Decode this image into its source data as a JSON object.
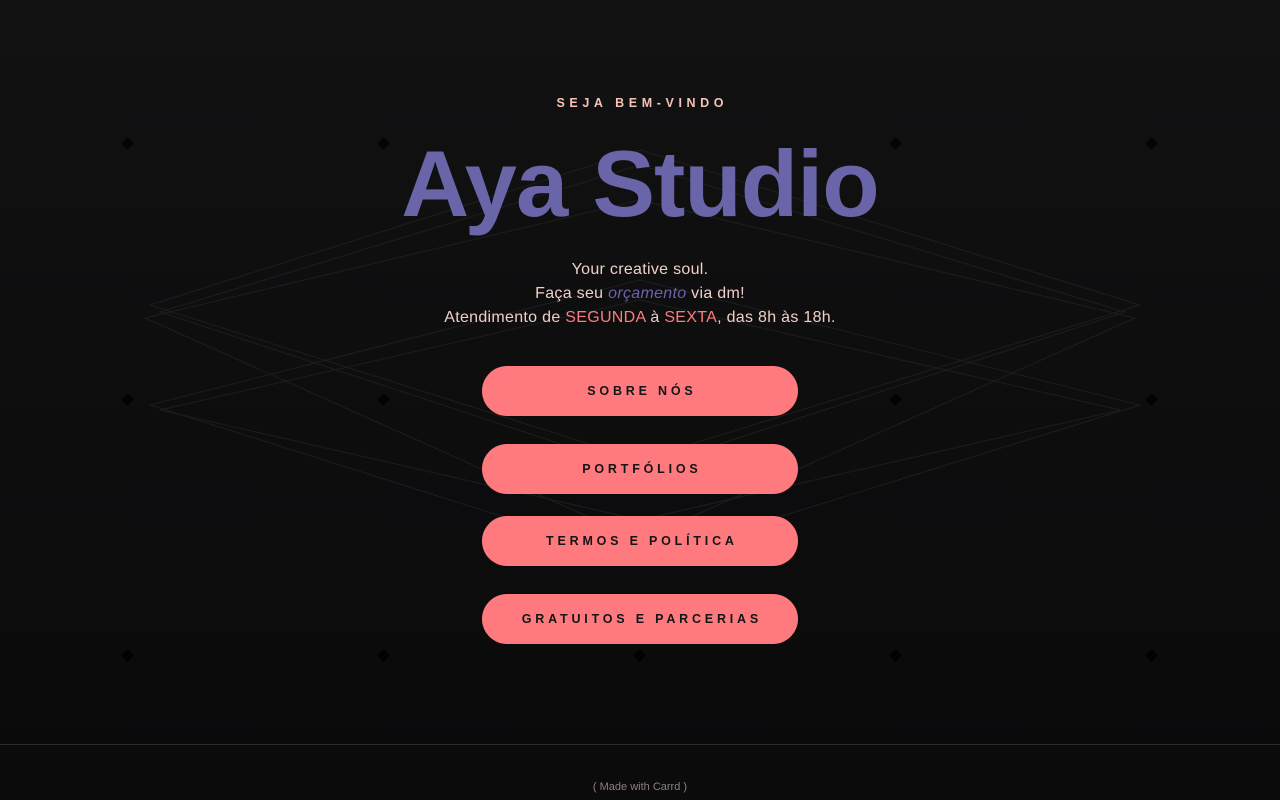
{
  "hero": {
    "eyebrow": "SEJA BEM-VINDO",
    "title": "Aya Studio",
    "line1": "Your creative soul.",
    "line2_pre": "Faça seu ",
    "line2_em": "orçamento",
    "line2_post": " via dm!",
    "line3_pre": "Atendimento de ",
    "line3_day1": "SEGUNDA",
    "line3_mid": " à ",
    "line3_day2": "SEXTA",
    "line3_post": ", das 8h às 18h."
  },
  "buttons": {
    "about": "SOBRE NÓS",
    "portfolios": "PORTFÓLIOS",
    "terms": "TERMOS E POLÍTICA",
    "free": "GRATUITOS E PARCERIAS"
  },
  "footer": {
    "credit": "( Made with Carrd )"
  },
  "colors": {
    "background": "#0d0d0e",
    "title": "#6a64a8",
    "accent": "#ff7a7e",
    "eyebrow": "#f3c3b5",
    "text": "#f0cfc6"
  }
}
